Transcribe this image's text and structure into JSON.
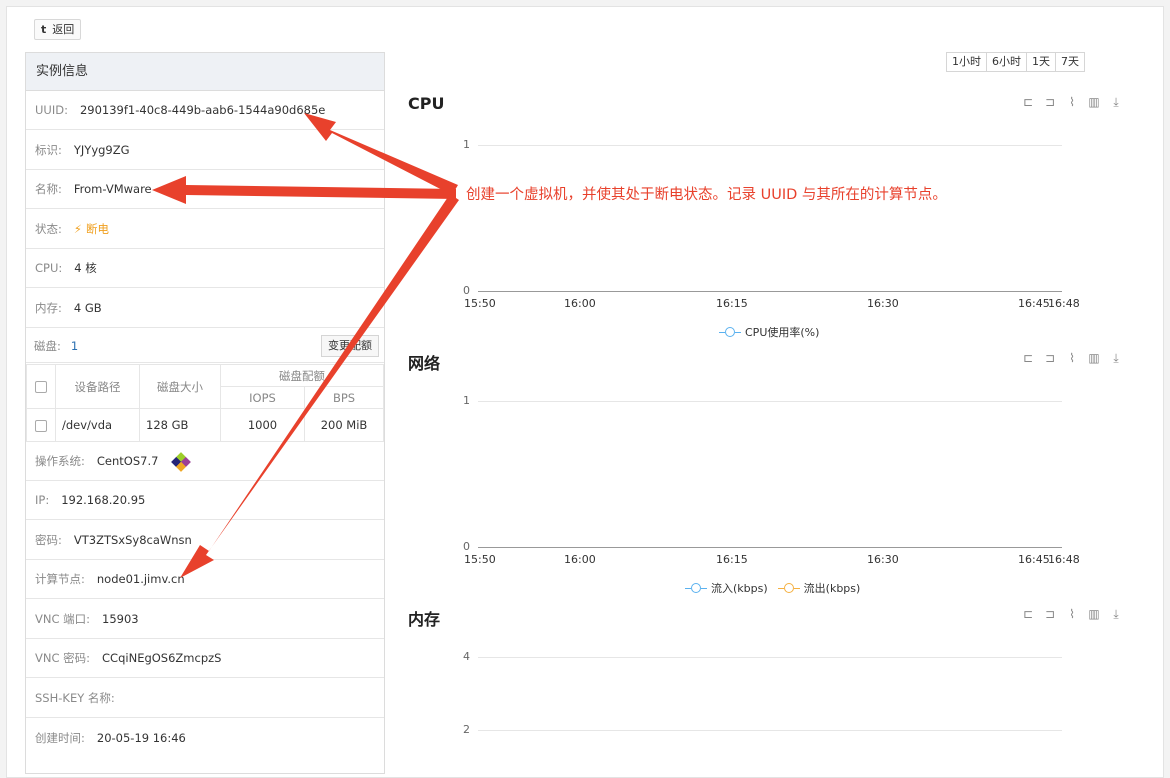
{
  "back_label": "返回",
  "back_icon": "t",
  "panel": {
    "title": "实例信息",
    "rows": [
      {
        "key": "UUID:",
        "value": "290139f1-40c8-449b-aab6-1544a90d685e"
      },
      {
        "key": "标识:",
        "value": "YJYyg9ZG"
      },
      {
        "key": "名称:",
        "value": "From-VMware"
      },
      {
        "key": "状态:",
        "value": "断电"
      },
      {
        "key": "CPU:",
        "value": "4 核"
      },
      {
        "key": "内存:",
        "value": "4 GB"
      }
    ],
    "disk": {
      "key": "磁盘:",
      "count": "1",
      "quota_button": "变更配额",
      "headers": {
        "path": "设备路径",
        "size": "磁盘大小",
        "quota": "磁盘配额",
        "iops": "IOPS",
        "bps": "BPS"
      },
      "rows": [
        {
          "path": "/dev/vda",
          "size": "128 GB",
          "iops": "1000",
          "bps": "200 MiB"
        }
      ]
    },
    "rows2": [
      {
        "key": "操作系统:",
        "value": "CentOS7.7"
      },
      {
        "key": "IP:",
        "value": "192.168.20.95"
      },
      {
        "key": "密码:",
        "value": "VT3ZTSxSy8caWnsn"
      },
      {
        "key": "计算节点:",
        "value": "node01.jimv.cn"
      },
      {
        "key": "VNC 端口:",
        "value": "15903"
      },
      {
        "key": "VNC 密码:",
        "value": "CCqiNEgOS6ZmcpzS"
      },
      {
        "key": "SSH-KEY 名称:",
        "value": ""
      },
      {
        "key": "创建时间:",
        "value": "20-05-19 16:46"
      }
    ]
  },
  "time_ranges": [
    "1小时",
    "6小时",
    "1天",
    "7天"
  ],
  "toolbox_icons": [
    "zoom-icon",
    "zoom-reset-icon",
    "line-chart-icon",
    "bar-chart-icon",
    "download-icon"
  ],
  "annotation": "创建一个虚拟机，并使其处于断电状态。记录 UUID 与其所在的计算节点。",
  "colors": {
    "annotation": "#e8412c",
    "status_off": "#f0a020",
    "series_in": "#5ab1ef",
    "series_out": "#f5b040"
  },
  "chart_data": [
    {
      "type": "line",
      "title": "CPU",
      "x": [
        "15:50",
        "16:00",
        "16:15",
        "16:30",
        "16:45",
        "16:48"
      ],
      "y_ticks": [
        "0",
        "1"
      ],
      "ylim": [
        0,
        1
      ],
      "series": [
        {
          "name": "CPU使用率(%)",
          "values": []
        }
      ],
      "legend": "bottom"
    },
    {
      "type": "line",
      "title": "网络",
      "x": [
        "15:50",
        "16:00",
        "16:15",
        "16:30",
        "16:45",
        "16:48"
      ],
      "y_ticks": [
        "0",
        "1"
      ],
      "ylim": [
        0,
        1
      ],
      "series": [
        {
          "name": "流入(kbps)",
          "values": []
        },
        {
          "name": "流出(kbps)",
          "values": []
        }
      ],
      "legend": "bottom"
    },
    {
      "type": "line",
      "title": "内存",
      "y_ticks": [
        "2",
        "4"
      ],
      "series": []
    }
  ]
}
